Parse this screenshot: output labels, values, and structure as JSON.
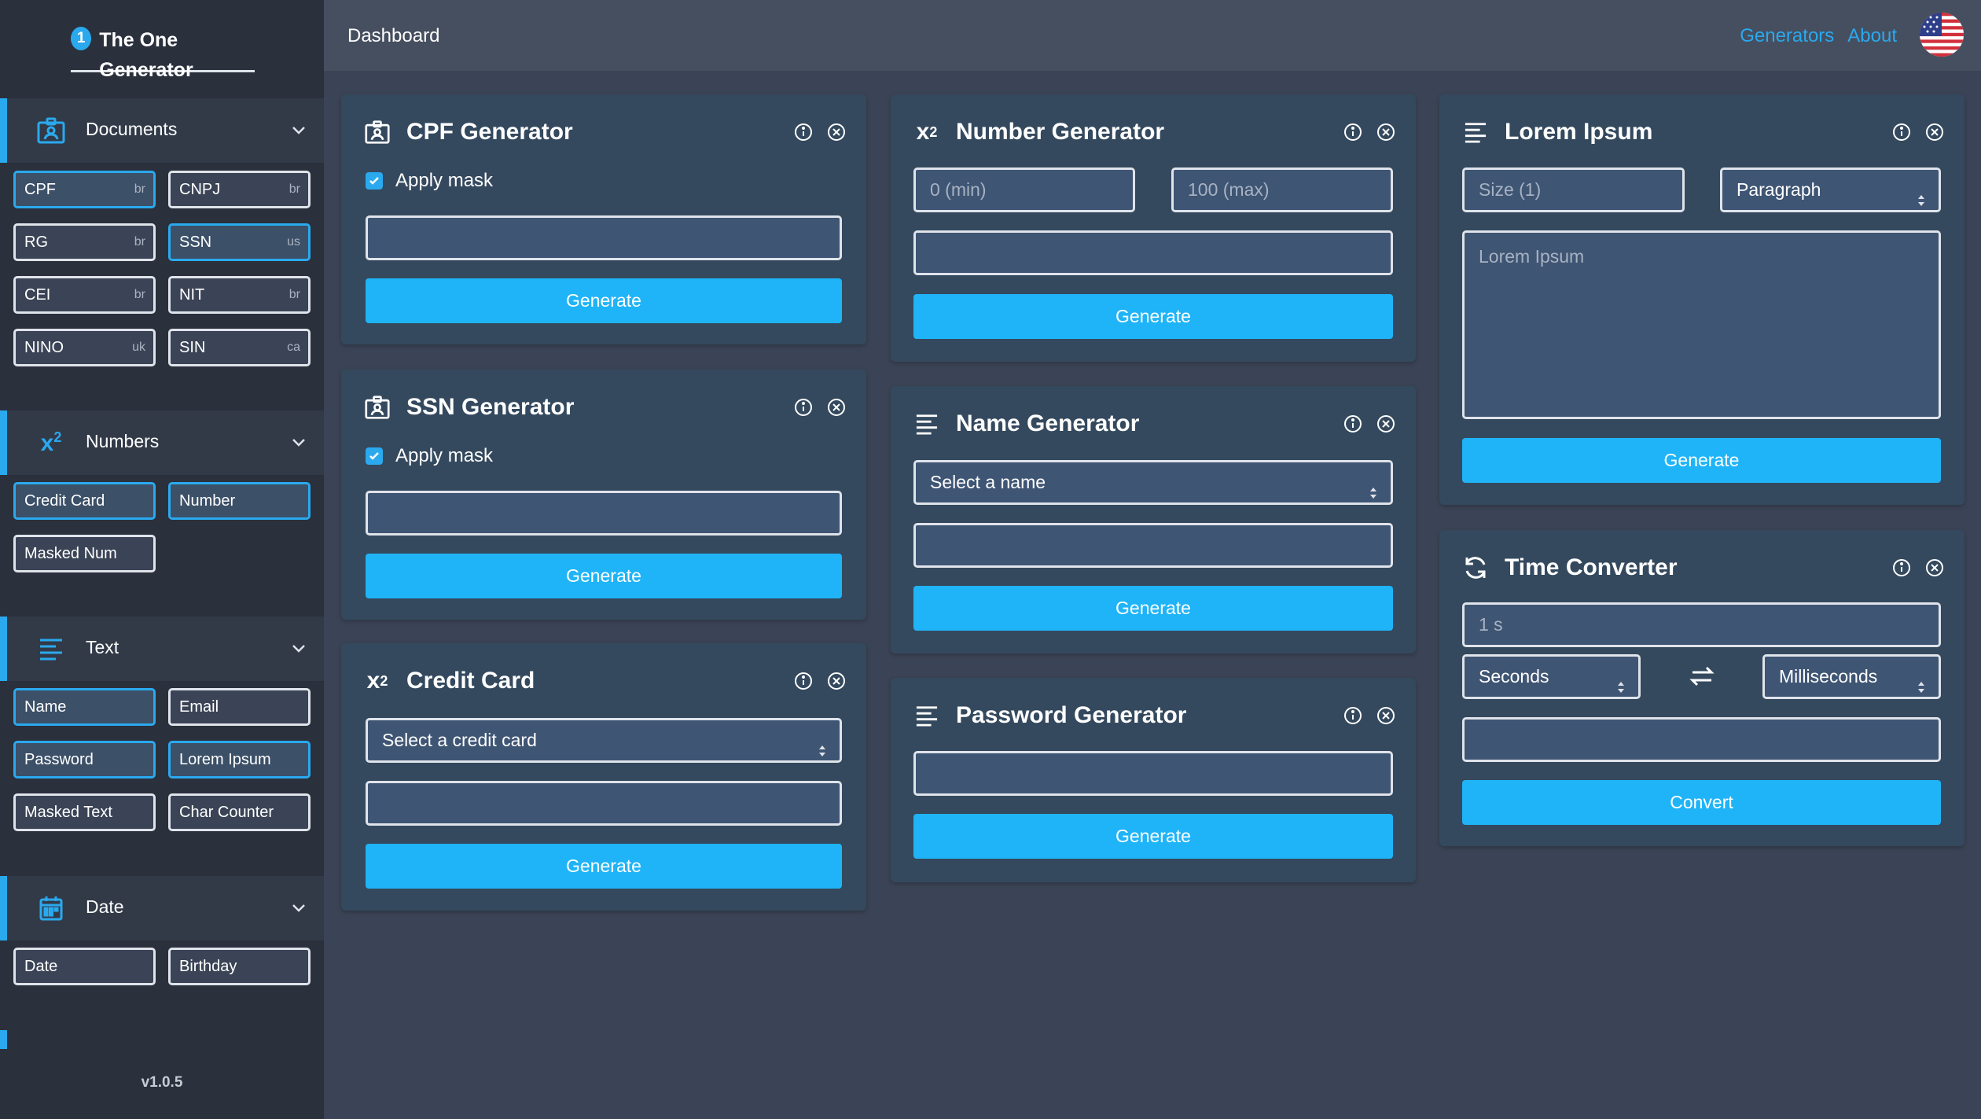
{
  "app": {
    "badge": "1",
    "title": "The One Generator",
    "version": "v1.0.5"
  },
  "topbar": {
    "breadcrumb": "Dashboard",
    "nav": {
      "generators": "Generators",
      "about": "About"
    }
  },
  "colors": {
    "accent": "#2aa9ee",
    "button": "#1fb4f7",
    "sidebar": "#2a303c",
    "card": "#34495e"
  },
  "sidebar": {
    "documents": {
      "label": "Documents",
      "icon": "id-card-icon",
      "items": [
        {
          "label": "CPF",
          "country": "br",
          "selected": true
        },
        {
          "label": "CNPJ",
          "country": "br",
          "selected": false
        },
        {
          "label": "RG",
          "country": "br",
          "selected": false
        },
        {
          "label": "SSN",
          "country": "us",
          "selected": true
        },
        {
          "label": "CEI",
          "country": "br",
          "selected": false
        },
        {
          "label": "NIT",
          "country": "br",
          "selected": false
        },
        {
          "label": "NINO",
          "country": "uk",
          "selected": false
        },
        {
          "label": "SIN",
          "country": "ca",
          "selected": false
        }
      ]
    },
    "numbers": {
      "label": "Numbers",
      "icon": "superscript-icon",
      "items": [
        {
          "label": "Credit Card",
          "selected": true
        },
        {
          "label": "Number",
          "selected": true
        },
        {
          "label": "Masked Num",
          "selected": false
        }
      ]
    },
    "text": {
      "label": "Text",
      "icon": "text-lines-icon",
      "items": [
        {
          "label": "Name",
          "selected": true
        },
        {
          "label": "Email",
          "selected": false
        },
        {
          "label": "Password",
          "selected": true
        },
        {
          "label": "Lorem Ipsum",
          "selected": true
        },
        {
          "label": "Masked Text",
          "selected": false
        },
        {
          "label": "Char Counter",
          "selected": false
        }
      ]
    },
    "date": {
      "label": "Date",
      "icon": "calendar-icon",
      "items": [
        {
          "label": "Date",
          "selected": false
        },
        {
          "label": "Birthday",
          "selected": false
        }
      ]
    }
  },
  "cards": {
    "cpf": {
      "title": "CPF Generator",
      "icon": "id-card-icon",
      "mask_label": "Apply mask",
      "output": "",
      "button": "Generate"
    },
    "ssn": {
      "title": "SSN Generator",
      "icon": "id-card-icon",
      "mask_label": "Apply mask",
      "output": "",
      "button": "Generate"
    },
    "credit": {
      "title": "Credit Card",
      "icon": "superscript-icon",
      "select": "Select a credit card",
      "output": "",
      "button": "Generate"
    },
    "number": {
      "title": "Number Generator",
      "icon": "superscript-icon",
      "min_placeholder": "0 (min)",
      "max_placeholder": "100 (max)",
      "output": "",
      "button": "Generate"
    },
    "name": {
      "title": "Name Generator",
      "icon": "text-lines-icon",
      "select": "Select a name",
      "output": "",
      "button": "Generate"
    },
    "password": {
      "title": "Password Generator",
      "icon": "text-lines-icon",
      "output": "",
      "button": "Generate"
    },
    "lorem": {
      "title": "Lorem Ipsum",
      "icon": "text-lines-icon",
      "size_placeholder": "Size (1)",
      "type_select": "Paragraph",
      "text_placeholder": "Lorem Ipsum",
      "button": "Generate"
    },
    "time": {
      "title": "Time Converter",
      "icon": "refresh-icon",
      "input_placeholder": "1 s",
      "from_unit": "Seconds",
      "to_unit": "Milliseconds",
      "output": "",
      "button": "Convert"
    }
  }
}
